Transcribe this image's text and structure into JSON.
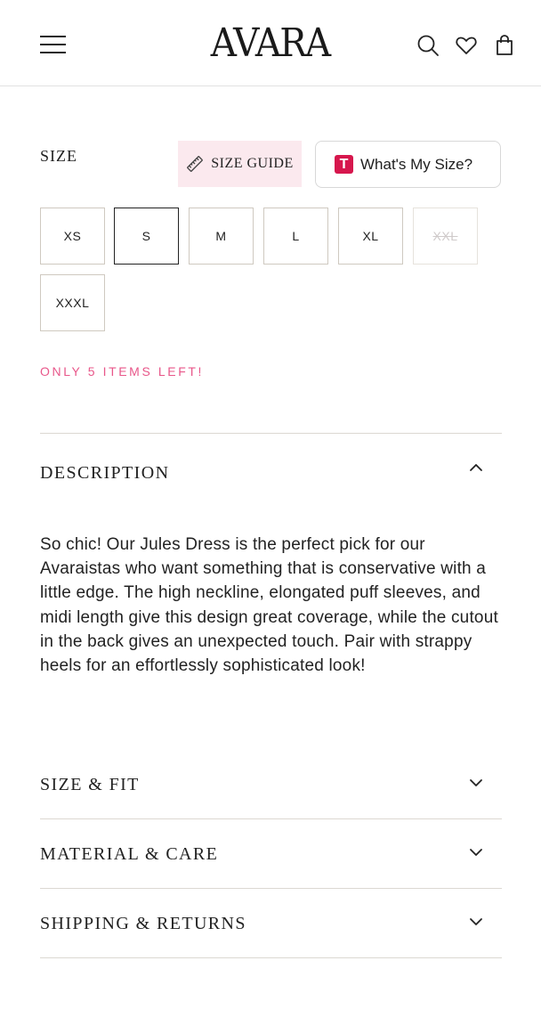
{
  "header": {
    "logo": "AVARA",
    "icons": [
      "menu-icon",
      "search-icon",
      "heart-icon",
      "bag-icon"
    ]
  },
  "size_selector": {
    "label": "SIZE",
    "size_guide_label": "SIZE GUIDE",
    "whats_my_size_label": "What's My Size?",
    "sizes": [
      {
        "label": "XS",
        "state": "available"
      },
      {
        "label": "S",
        "state": "selected"
      },
      {
        "label": "M",
        "state": "available"
      },
      {
        "label": "L",
        "state": "available"
      },
      {
        "label": "XL",
        "state": "available"
      },
      {
        "label": "XXL",
        "state": "sold-out"
      },
      {
        "label": "XXXL",
        "state": "available"
      }
    ],
    "stock_note": "ONLY 5 ITEMS LEFT!"
  },
  "accordions": {
    "description": {
      "title": "DESCRIPTION",
      "expanded": true,
      "body": "So chic! Our Jules Dress is the perfect pick for our Avaraistas who want something that is conservative with a little edge. The high neckline, elongated puff sleeves, and midi length give this design great coverage, while the cutout in the back gives an unexpected touch. Pair with strappy heels for an effortlessly sophisticated look!"
    },
    "size_fit": {
      "title": "SIZE & FIT",
      "expanded": false
    },
    "material_care": {
      "title": "MATERIAL & CARE",
      "expanded": false
    },
    "shipping_returns": {
      "title": "SHIPPING & RETURNS",
      "expanded": false
    }
  },
  "colors": {
    "accent_pink": "#e8578a",
    "size_guide_bg": "#fbe9ee",
    "brand_red": "#d6174d",
    "text": "#1e1e1e"
  }
}
